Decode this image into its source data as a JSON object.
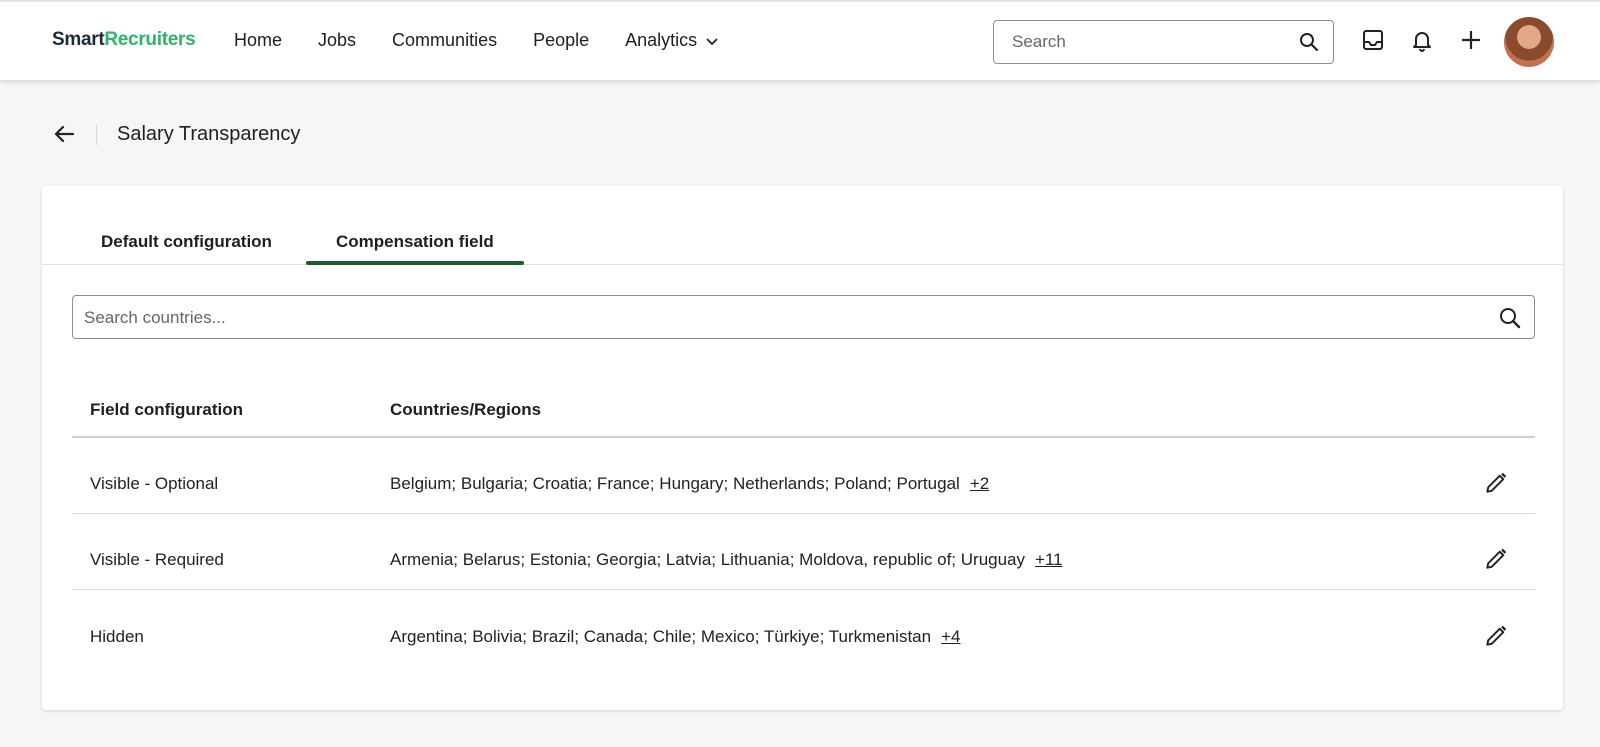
{
  "header": {
    "logo_part1": "Smart",
    "logo_part2": "Recruiters",
    "nav": [
      "Home",
      "Jobs",
      "Communities",
      "People",
      "Analytics"
    ],
    "search_placeholder": "Search",
    "icons": [
      "inbox-icon",
      "bell-icon",
      "plus-icon"
    ]
  },
  "page": {
    "title": "Salary Transparency"
  },
  "tabs": [
    {
      "label": "Default configuration",
      "active": false
    },
    {
      "label": "Compensation field",
      "active": true
    }
  ],
  "country_search": {
    "placeholder": "Search countries..."
  },
  "table": {
    "columns": [
      "Field configuration",
      "Countries/Regions"
    ],
    "rows": [
      {
        "config": "Visible - Optional",
        "countries": "Belgium; Bulgaria; Croatia; France; Hungary; Netherlands; Poland; Portugal",
        "more": "+2"
      },
      {
        "config": "Visible - Required",
        "countries": "Armenia; Belarus; Estonia; Georgia; Latvia; Lithuania; Moldova, republic of; Uruguay",
        "more": "+11"
      },
      {
        "config": "Hidden",
        "countries": "Argentina; Bolivia; Brazil; Canada; Chile; Mexico; Türkiye; Turkmenistan",
        "more": "+4"
      }
    ]
  },
  "colors": {
    "brand_green": "#2fb36b",
    "brand_dark": "#1b2b3a",
    "tab_indicator": "#1d5a2f"
  }
}
